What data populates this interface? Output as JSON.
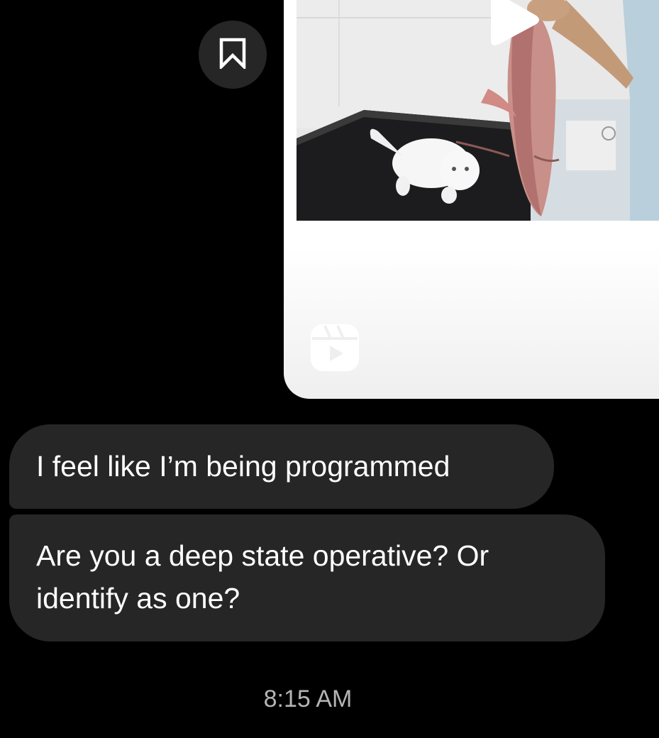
{
  "shared_reel": {
    "save_icon": "bookmark-icon",
    "media_type_icon": "reels-icon",
    "play_icon": "play-icon",
    "thumbnail_description": "video thumbnail"
  },
  "messages": [
    {
      "text": "I feel like I’m being programmed"
    },
    {
      "text": "Are you a deep state operative? Or identify as one?"
    }
  ],
  "timestamp": "8:15 AM",
  "colors": {
    "background": "#000000",
    "bubble": "#262626",
    "timestamp": "#b4b4b4",
    "card": "#ffffff"
  }
}
